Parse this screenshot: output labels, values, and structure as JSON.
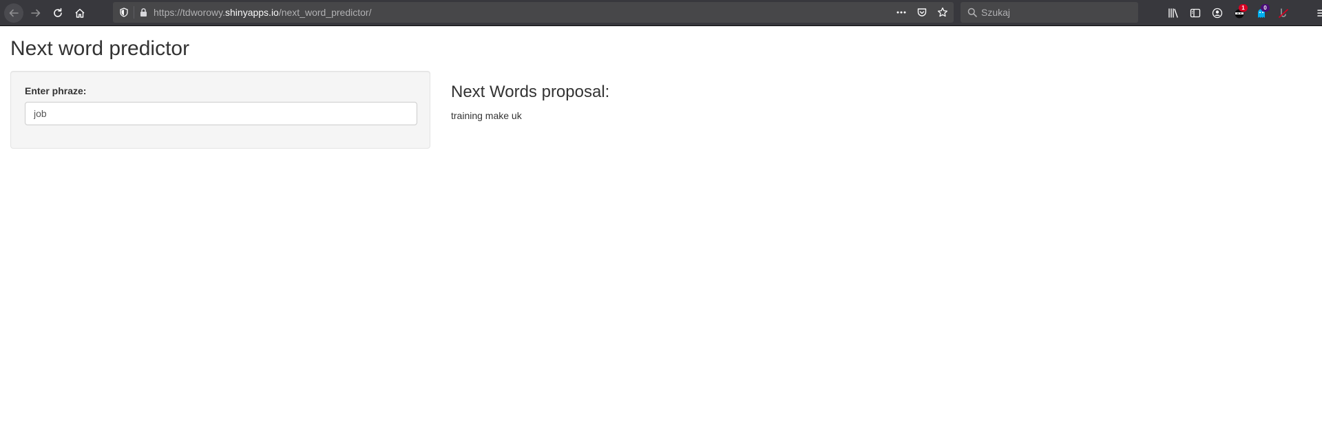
{
  "browser": {
    "url": {
      "scheme_prefix": "https://tdworowy.",
      "domain": "shinyapps.io",
      "path": "/next_word_predictor/"
    },
    "search_placeholder": "Szukaj",
    "badges": {
      "extension1": "1",
      "extension2": "0"
    },
    "icons": {
      "back": "back-arrow-icon",
      "forward": "forward-arrow-icon",
      "reload": "reload-icon",
      "home": "home-icon",
      "shield": "tracking-shield-icon",
      "lock": "lock-icon",
      "more": "more-dots-icon",
      "pocket": "pocket-icon",
      "bookmark": "star-icon",
      "search": "search-icon",
      "library": "library-icon",
      "sidebar": "sidebar-icon",
      "account": "account-icon",
      "menu": "hamburger-menu-icon"
    }
  },
  "app": {
    "title": "Next word predictor",
    "input_label": "Enter phraze:",
    "input_value": "job",
    "result_heading": "Next Words proposal:",
    "result_text": "training make uk"
  }
}
